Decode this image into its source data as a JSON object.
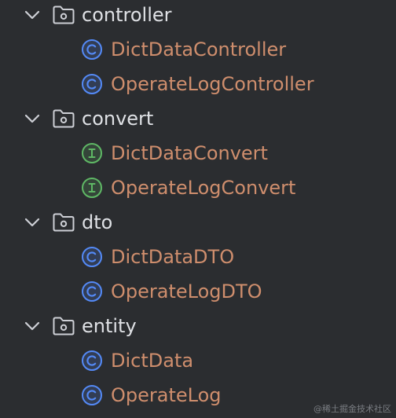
{
  "colors": {
    "background": "#2b2d30",
    "folder_text": "#dfe1e5",
    "file_text": "#cf8e6d",
    "class_icon": "#548af7",
    "interface_icon": "#5fb865",
    "folder_icon": "#ced0d6",
    "chevron": "#ced0d6"
  },
  "tree": [
    {
      "folder": "controller",
      "icon": "folder-icon",
      "expanded": true,
      "files": [
        {
          "name": "DictDataController",
          "kind": "class",
          "icon_letter": "C"
        },
        {
          "name": "OperateLogController",
          "kind": "class",
          "icon_letter": "C"
        }
      ]
    },
    {
      "folder": "convert",
      "icon": "folder-icon",
      "expanded": true,
      "files": [
        {
          "name": "DictDataConvert",
          "kind": "interface",
          "icon_letter": "I"
        },
        {
          "name": "OperateLogConvert",
          "kind": "interface",
          "icon_letter": "I"
        }
      ]
    },
    {
      "folder": "dto",
      "icon": "folder-icon",
      "expanded": true,
      "files": [
        {
          "name": "DictDataDTO",
          "kind": "class",
          "icon_letter": "C"
        },
        {
          "name": "OperateLogDTO",
          "kind": "class",
          "icon_letter": "C"
        }
      ]
    },
    {
      "folder": "entity",
      "icon": "folder-icon",
      "expanded": true,
      "files": [
        {
          "name": "DictData",
          "kind": "class",
          "icon_letter": "C"
        },
        {
          "name": "OperateLog",
          "kind": "class",
          "icon_letter": "C"
        }
      ]
    }
  ],
  "watermark": "@稀土掘金技术社区"
}
